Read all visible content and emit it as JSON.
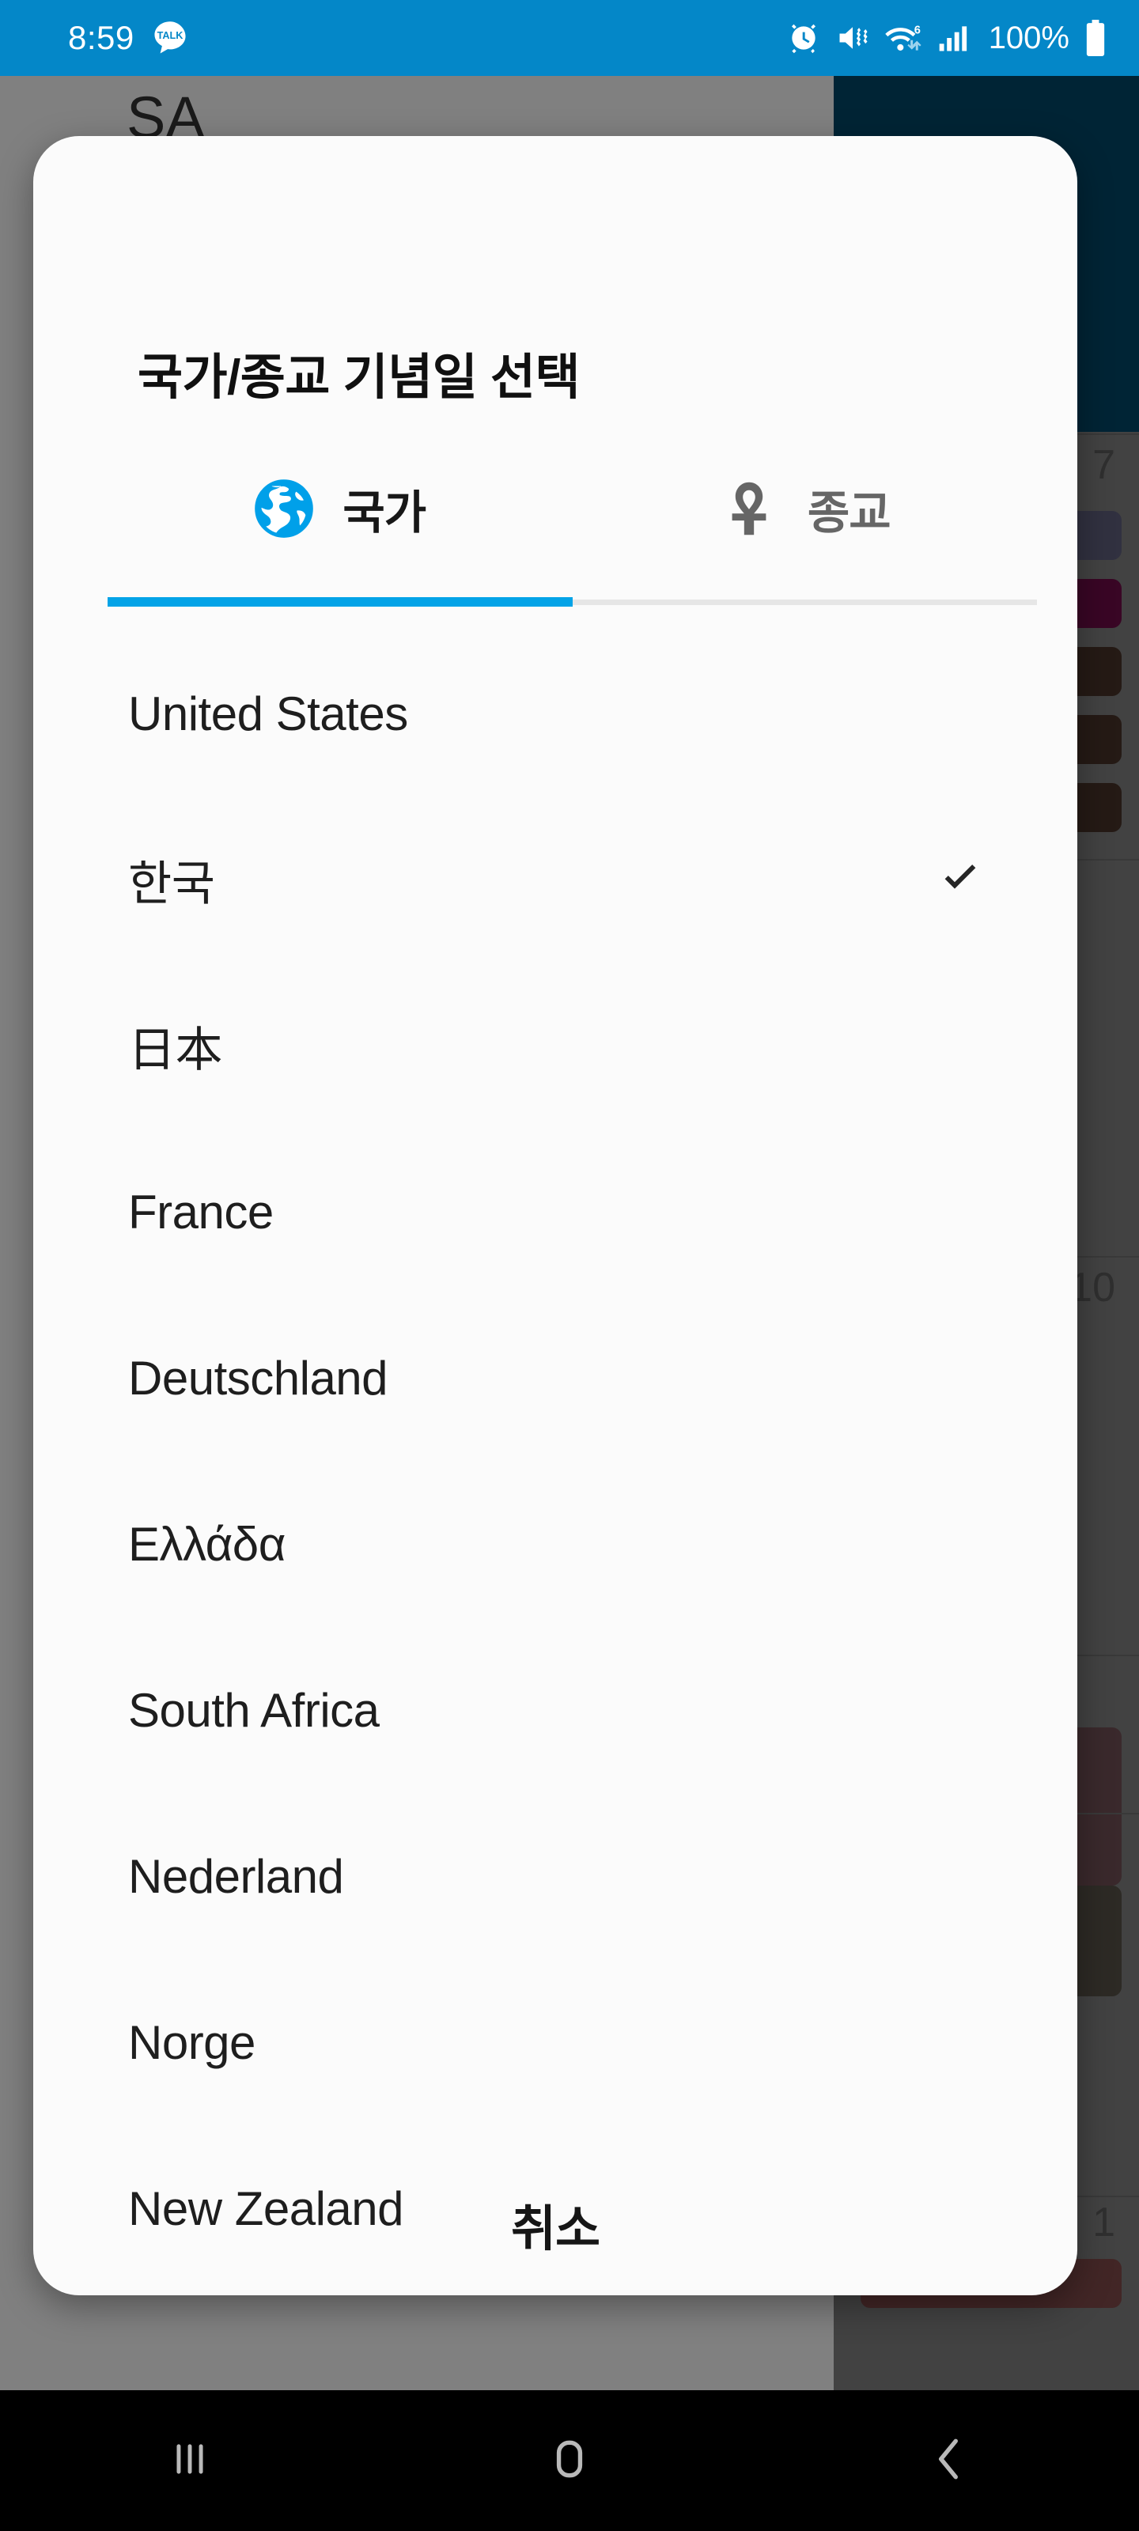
{
  "status_bar": {
    "time": "8:59",
    "battery_percent": "100%",
    "background_color": "#0487c8",
    "icons": [
      "kakaotalk-icon",
      "alarm-icon",
      "mute-vibrate-icon",
      "wifi-6-icon",
      "signal-bars-icon",
      "battery-icon"
    ]
  },
  "background_app": {
    "title": "SA",
    "header_color": "#013b56",
    "calendar_day_numbers": [
      "7",
      "10",
      "1"
    ],
    "event_pill_colors": [
      "#4f5068",
      "#5c0a3c",
      "#3c2a22",
      "#3c2a22",
      "#3c2a22",
      "#5e4347",
      "#4a443c",
      "#6b3e3e"
    ]
  },
  "dialog": {
    "title": "국가/종교 기념일 선택",
    "accent_color": "#03a3e7",
    "tabs": [
      {
        "label": "국가",
        "icon": "globe-icon",
        "active": true
      },
      {
        "label": "종교",
        "icon": "ankh-icon",
        "active": false
      }
    ],
    "items": [
      {
        "label": "United States",
        "selected": false
      },
      {
        "label": "한국",
        "selected": true
      },
      {
        "label": "日本",
        "selected": false
      },
      {
        "label": "France",
        "selected": false
      },
      {
        "label": "Deutschland",
        "selected": false
      },
      {
        "label": "Ελλάδα",
        "selected": false
      },
      {
        "label": "South Africa",
        "selected": false
      },
      {
        "label": "Nederland",
        "selected": false
      },
      {
        "label": "Norge",
        "selected": false
      },
      {
        "label": "New Zealand",
        "selected": false
      }
    ],
    "cancel_label": "취소"
  },
  "nav_bar": {
    "buttons": [
      {
        "name": "recents",
        "icon": "recents-icon"
      },
      {
        "name": "home",
        "icon": "home-icon"
      },
      {
        "name": "back",
        "icon": "back-icon"
      }
    ]
  }
}
